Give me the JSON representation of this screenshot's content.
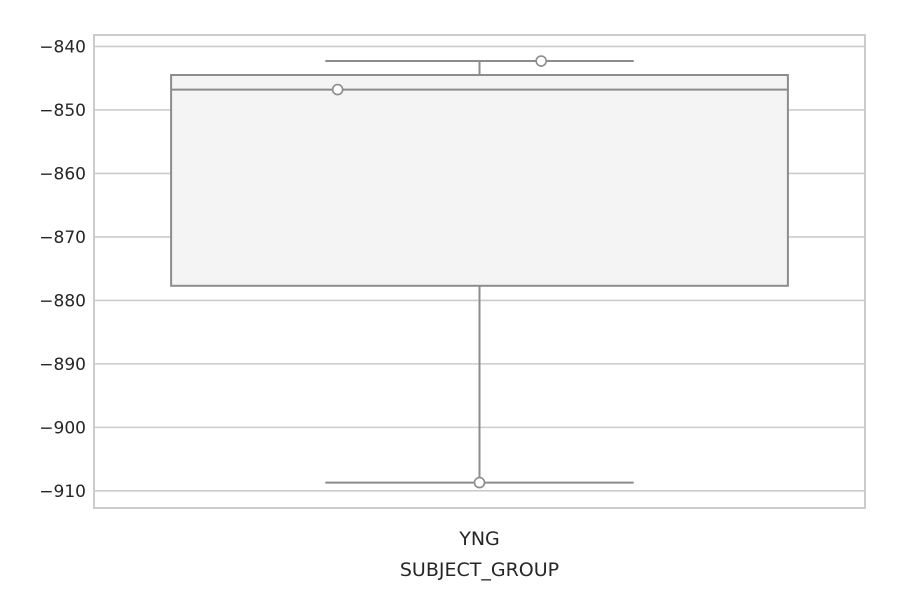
{
  "chart_data": {
    "type": "box",
    "categories": [
      "YNG"
    ],
    "xlabel": "SUBJECT_GROUP",
    "ylabel": "",
    "ylim": [
      -912.7,
      -838.2
    ],
    "yticks": [
      -840,
      -850,
      -860,
      -870,
      -880,
      -890,
      -900,
      -910
    ],
    "ytick_labels": [
      "−840",
      "−850",
      "−860",
      "−870",
      "−880",
      "−890",
      "−900",
      "−910"
    ],
    "grid": true,
    "boxes": [
      {
        "category": "YNG",
        "whisker_low": -908.7,
        "q1": -877.7,
        "median": -846.8,
        "q3": -844.5,
        "whisker_high": -842.3
      }
    ],
    "points": [
      {
        "category": "YNG",
        "value": -842.3,
        "offset": 0.1
      },
      {
        "category": "YNG",
        "value": -846.8,
        "offset": -0.23
      },
      {
        "category": "YNG",
        "value": -908.7,
        "offset": 0.0
      }
    ],
    "colors": {
      "box_fill": "#f4f4f4",
      "box_edge": "#8c8c8c",
      "grid": "#cccccc",
      "frame": "#cccccc",
      "text": "#262626",
      "point_fill": "#ffffff"
    }
  }
}
